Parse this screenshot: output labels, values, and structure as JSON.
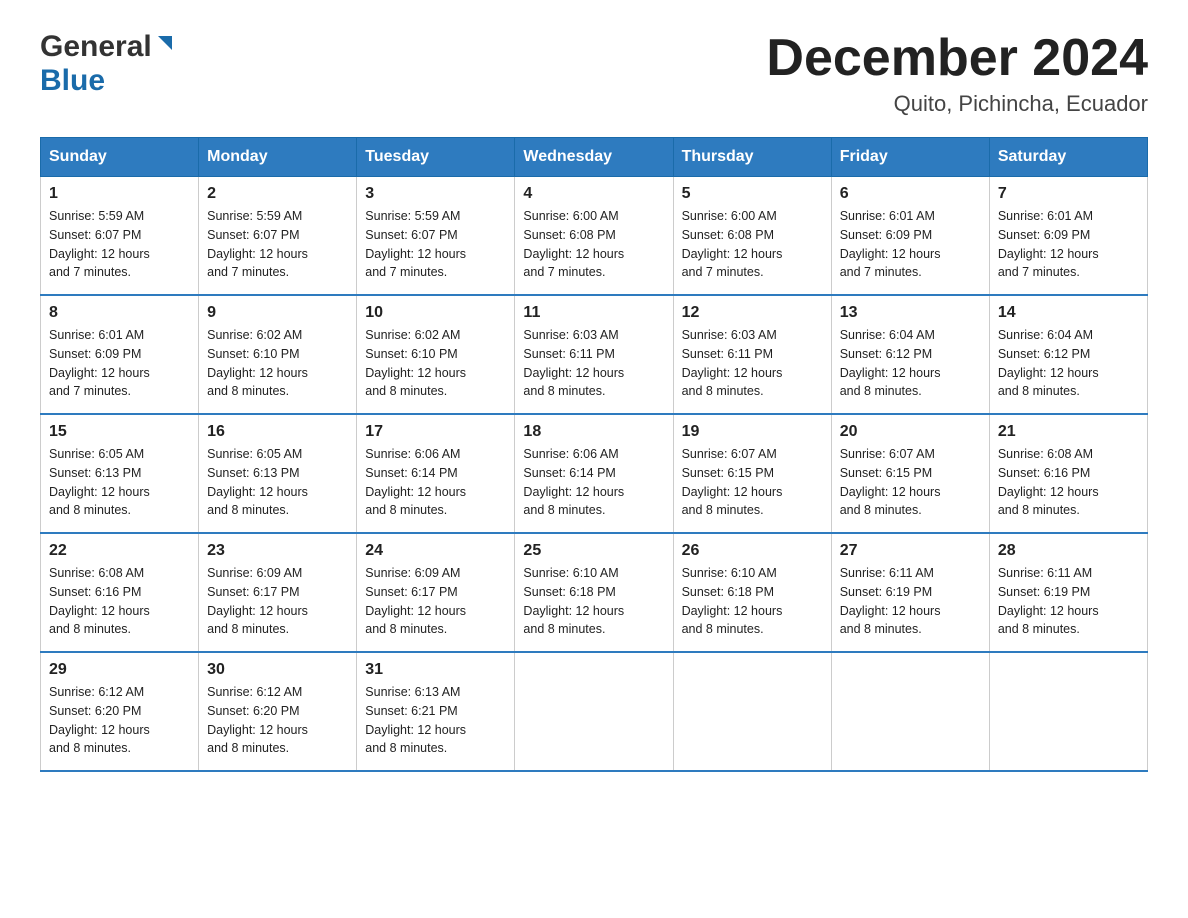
{
  "header": {
    "logo_general": "General",
    "logo_blue": "Blue",
    "month_title": "December 2024",
    "subtitle": "Quito, Pichincha, Ecuador"
  },
  "days_of_week": [
    "Sunday",
    "Monday",
    "Tuesday",
    "Wednesday",
    "Thursday",
    "Friday",
    "Saturday"
  ],
  "weeks": [
    [
      {
        "day": "1",
        "sunrise": "5:59 AM",
        "sunset": "6:07 PM",
        "daylight": "12 hours and 7 minutes."
      },
      {
        "day": "2",
        "sunrise": "5:59 AM",
        "sunset": "6:07 PM",
        "daylight": "12 hours and 7 minutes."
      },
      {
        "day": "3",
        "sunrise": "5:59 AM",
        "sunset": "6:07 PM",
        "daylight": "12 hours and 7 minutes."
      },
      {
        "day": "4",
        "sunrise": "6:00 AM",
        "sunset": "6:08 PM",
        "daylight": "12 hours and 7 minutes."
      },
      {
        "day": "5",
        "sunrise": "6:00 AM",
        "sunset": "6:08 PM",
        "daylight": "12 hours and 7 minutes."
      },
      {
        "day": "6",
        "sunrise": "6:01 AM",
        "sunset": "6:09 PM",
        "daylight": "12 hours and 7 minutes."
      },
      {
        "day": "7",
        "sunrise": "6:01 AM",
        "sunset": "6:09 PM",
        "daylight": "12 hours and 7 minutes."
      }
    ],
    [
      {
        "day": "8",
        "sunrise": "6:01 AM",
        "sunset": "6:09 PM",
        "daylight": "12 hours and 7 minutes."
      },
      {
        "day": "9",
        "sunrise": "6:02 AM",
        "sunset": "6:10 PM",
        "daylight": "12 hours and 8 minutes."
      },
      {
        "day": "10",
        "sunrise": "6:02 AM",
        "sunset": "6:10 PM",
        "daylight": "12 hours and 8 minutes."
      },
      {
        "day": "11",
        "sunrise": "6:03 AM",
        "sunset": "6:11 PM",
        "daylight": "12 hours and 8 minutes."
      },
      {
        "day": "12",
        "sunrise": "6:03 AM",
        "sunset": "6:11 PM",
        "daylight": "12 hours and 8 minutes."
      },
      {
        "day": "13",
        "sunrise": "6:04 AM",
        "sunset": "6:12 PM",
        "daylight": "12 hours and 8 minutes."
      },
      {
        "day": "14",
        "sunrise": "6:04 AM",
        "sunset": "6:12 PM",
        "daylight": "12 hours and 8 minutes."
      }
    ],
    [
      {
        "day": "15",
        "sunrise": "6:05 AM",
        "sunset": "6:13 PM",
        "daylight": "12 hours and 8 minutes."
      },
      {
        "day": "16",
        "sunrise": "6:05 AM",
        "sunset": "6:13 PM",
        "daylight": "12 hours and 8 minutes."
      },
      {
        "day": "17",
        "sunrise": "6:06 AM",
        "sunset": "6:14 PM",
        "daylight": "12 hours and 8 minutes."
      },
      {
        "day": "18",
        "sunrise": "6:06 AM",
        "sunset": "6:14 PM",
        "daylight": "12 hours and 8 minutes."
      },
      {
        "day": "19",
        "sunrise": "6:07 AM",
        "sunset": "6:15 PM",
        "daylight": "12 hours and 8 minutes."
      },
      {
        "day": "20",
        "sunrise": "6:07 AM",
        "sunset": "6:15 PM",
        "daylight": "12 hours and 8 minutes."
      },
      {
        "day": "21",
        "sunrise": "6:08 AM",
        "sunset": "6:16 PM",
        "daylight": "12 hours and 8 minutes."
      }
    ],
    [
      {
        "day": "22",
        "sunrise": "6:08 AM",
        "sunset": "6:16 PM",
        "daylight": "12 hours and 8 minutes."
      },
      {
        "day": "23",
        "sunrise": "6:09 AM",
        "sunset": "6:17 PM",
        "daylight": "12 hours and 8 minutes."
      },
      {
        "day": "24",
        "sunrise": "6:09 AM",
        "sunset": "6:17 PM",
        "daylight": "12 hours and 8 minutes."
      },
      {
        "day": "25",
        "sunrise": "6:10 AM",
        "sunset": "6:18 PM",
        "daylight": "12 hours and 8 minutes."
      },
      {
        "day": "26",
        "sunrise": "6:10 AM",
        "sunset": "6:18 PM",
        "daylight": "12 hours and 8 minutes."
      },
      {
        "day": "27",
        "sunrise": "6:11 AM",
        "sunset": "6:19 PM",
        "daylight": "12 hours and 8 minutes."
      },
      {
        "day": "28",
        "sunrise": "6:11 AM",
        "sunset": "6:19 PM",
        "daylight": "12 hours and 8 minutes."
      }
    ],
    [
      {
        "day": "29",
        "sunrise": "6:12 AM",
        "sunset": "6:20 PM",
        "daylight": "12 hours and 8 minutes."
      },
      {
        "day": "30",
        "sunrise": "6:12 AM",
        "sunset": "6:20 PM",
        "daylight": "12 hours and 8 minutes."
      },
      {
        "day": "31",
        "sunrise": "6:13 AM",
        "sunset": "6:21 PM",
        "daylight": "12 hours and 8 minutes."
      },
      null,
      null,
      null,
      null
    ]
  ],
  "labels": {
    "sunrise": "Sunrise:",
    "sunset": "Sunset:",
    "daylight": "Daylight:"
  }
}
